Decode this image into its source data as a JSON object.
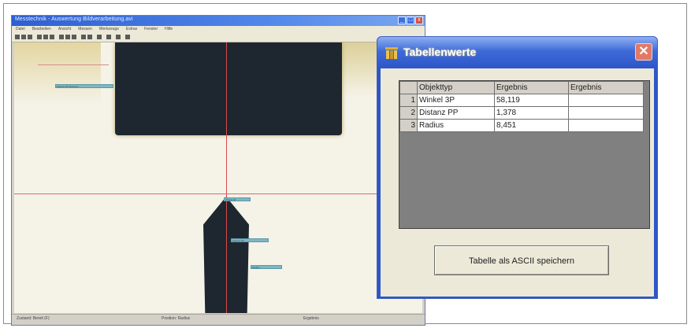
{
  "main_window": {
    "title": "Messtechnik - Auswertung Bildverarbeitung.avi",
    "menu": [
      "Datei",
      "Bearbeiten",
      "Ansicht",
      "Messen",
      "Werkzeuge",
      "Extras",
      "Fenster",
      "Hilfe"
    ],
    "title_buttons": [
      "_",
      "□",
      "x"
    ],
    "labels": [
      "Distanz PP Messung",
      "Winkel 3P",
      "Distanz PP",
      "Radius"
    ],
    "status": {
      "left": "Zustand: Bereit (F)",
      "middle": "Position: Radius",
      "right": "Ergebnis"
    }
  },
  "dialog": {
    "title": "Tabellenwerte",
    "close_glyph": "✕",
    "table": {
      "headers": [
        "Objekttyp",
        "Ergebnis",
        "Ergebnis"
      ],
      "rows": [
        {
          "num": "1",
          "type": "Winkel 3P",
          "value": "58,119",
          "value2": ""
        },
        {
          "num": "2",
          "type": "Distanz PP",
          "value": "1,378",
          "value2": ""
        },
        {
          "num": "3",
          "type": "Radius",
          "value": "8,451",
          "value2": ""
        }
      ]
    },
    "save_button": "Tabelle als ASCII speichern"
  },
  "colors": {
    "dialog_title": "#2d56c8",
    "close_button": "#e27966",
    "measure_line": "#d94a4a",
    "label_fill": "#7fb6c3",
    "sample_dark": "#1e2730"
  }
}
